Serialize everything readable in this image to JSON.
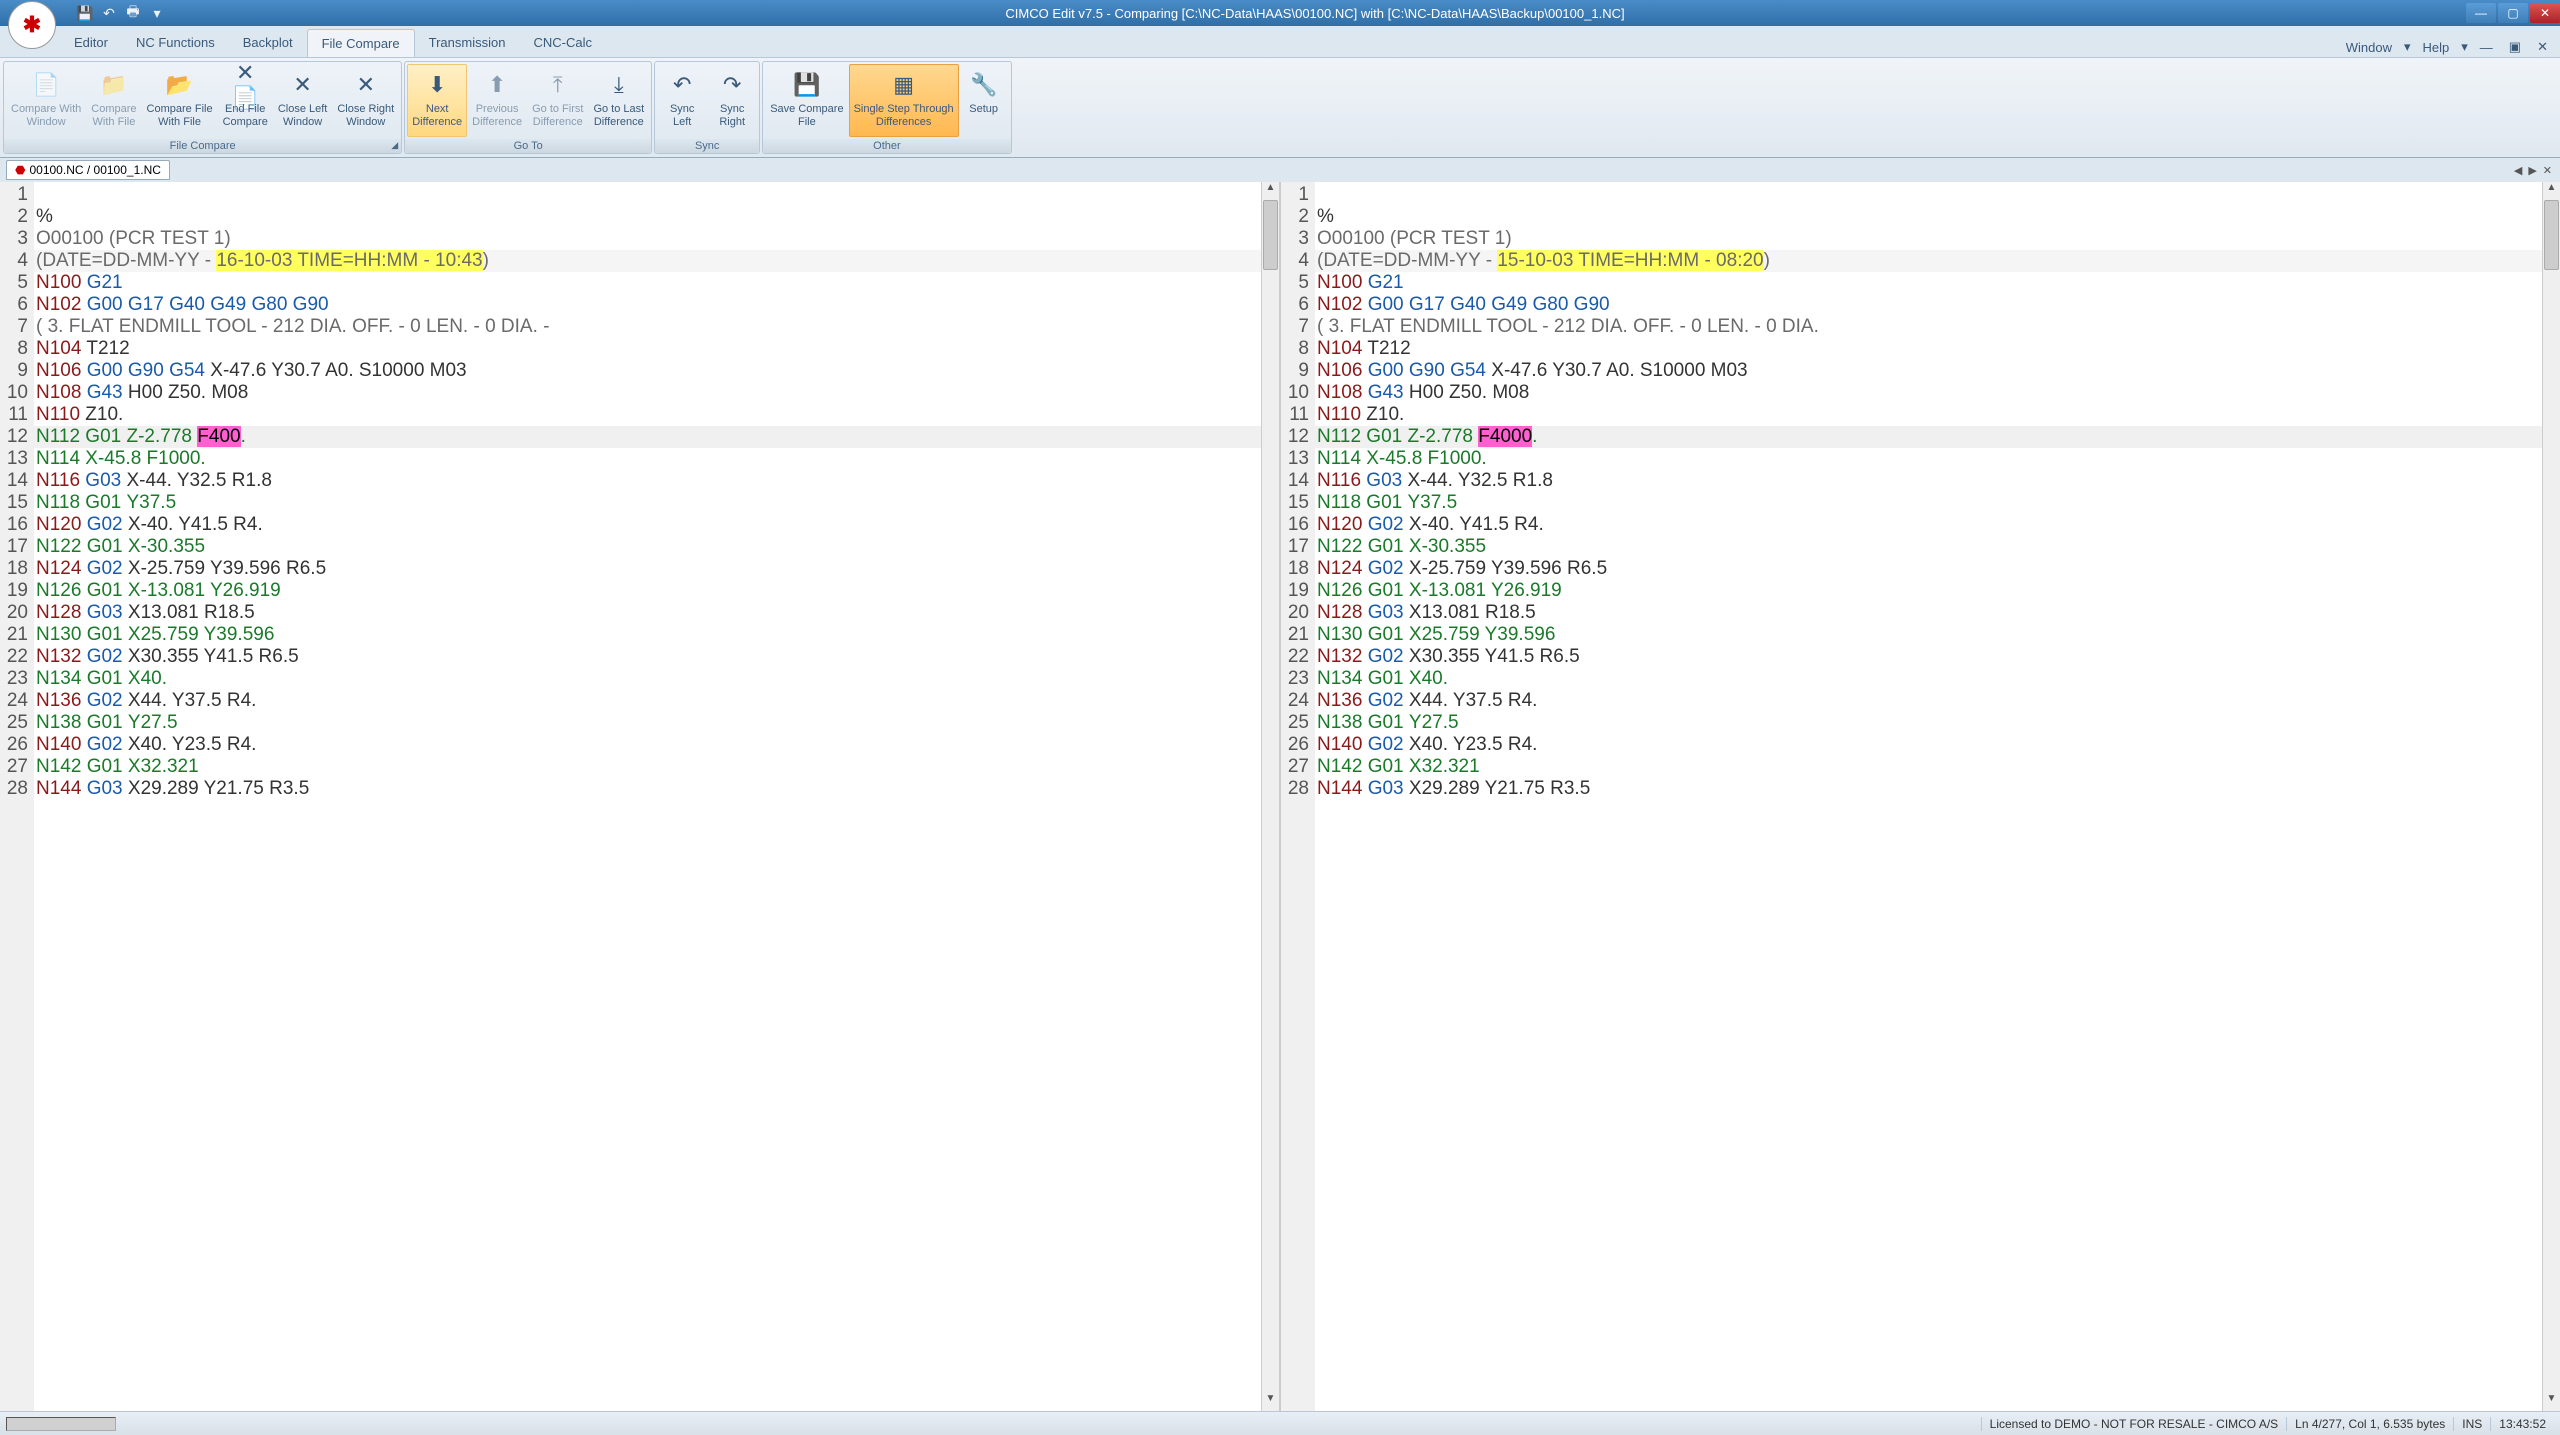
{
  "title": "CIMCO Edit v7.5 - Comparing [C:\\NC-Data\\HAAS\\00100.NC] with [C:\\NC-Data\\HAAS\\Backup\\00100_1.NC]",
  "menu_tabs": [
    "Editor",
    "NC Functions",
    "Backplot",
    "File Compare",
    "Transmission",
    "CNC-Calc"
  ],
  "active_tab": "File Compare",
  "menu_right": [
    "Window",
    "Help"
  ],
  "ribbon": {
    "groups": [
      {
        "label": "File Compare",
        "buttons": [
          {
            "label": "Compare With\nWindow",
            "icon": "📄",
            "disabled": true
          },
          {
            "label": "Compare\nWith File",
            "icon": "📁",
            "disabled": true
          },
          {
            "label": "Compare File\nWith File",
            "icon": "📂"
          },
          {
            "label": "End File\nCompare",
            "icon": "✕📄"
          },
          {
            "label": "Close Left\nWindow",
            "icon": "✕"
          },
          {
            "label": "Close Right\nWindow",
            "icon": "✕"
          }
        ],
        "launcher": true
      },
      {
        "label": "Go To",
        "buttons": [
          {
            "label": "Next\nDifference",
            "icon": "⬇",
            "highlight": true
          },
          {
            "label": "Previous\nDifference",
            "icon": "⬆",
            "disabled": true
          },
          {
            "label": "Go to First\nDifference",
            "icon": "⤒",
            "disabled": true
          },
          {
            "label": "Go to Last\nDifference",
            "icon": "⤓"
          }
        ]
      },
      {
        "label": "Sync",
        "buttons": [
          {
            "label": "Sync\nLeft",
            "icon": "↶"
          },
          {
            "label": "Sync\nRight",
            "icon": "↷"
          }
        ]
      },
      {
        "label": "Other",
        "buttons": [
          {
            "label": "Save Compare\nFile",
            "icon": "💾"
          },
          {
            "label": "Single Step Through\nDifferences",
            "icon": "▦",
            "orange": true
          },
          {
            "label": "Setup",
            "icon": "🔧"
          }
        ]
      }
    ]
  },
  "doc_tab": "00100.NC / 00100_1.NC",
  "left": {
    "lines": [
      {
        "n": 1,
        "tokens": [
          {
            "t": "",
            "c": "plain"
          }
        ]
      },
      {
        "n": 2,
        "tokens": [
          {
            "t": "%",
            "c": "plain"
          }
        ]
      },
      {
        "n": 3,
        "tokens": [
          {
            "t": "O00100 (PCR TEST 1)",
            "c": "comment"
          }
        ]
      },
      {
        "n": 4,
        "diff": true,
        "tokens": [
          {
            "t": "(DATE=DD-MM-YY - ",
            "c": "comment"
          },
          {
            "t": "16-10-03 TIME=HH:MM - 10:43",
            "c": "comment",
            "hl": "yellow"
          },
          {
            "t": ")",
            "c": "comment"
          }
        ]
      },
      {
        "n": 5,
        "tokens": [
          {
            "t": "N100 ",
            "c": "n"
          },
          {
            "t": "G21",
            "c": "g"
          }
        ]
      },
      {
        "n": 6,
        "tokens": [
          {
            "t": "N102 ",
            "c": "n"
          },
          {
            "t": "G00 G17 G40 G49 G80 G90",
            "c": "g"
          }
        ]
      },
      {
        "n": 7,
        "tokens": [
          {
            "t": "( 3. FLAT ENDMILL TOOL - 212 DIA. OFF. - 0 LEN. - 0 DIA. -",
            "c": "comment"
          }
        ]
      },
      {
        "n": 8,
        "tokens": [
          {
            "t": "N104 ",
            "c": "n"
          },
          {
            "t": "T212",
            "c": "plain"
          }
        ]
      },
      {
        "n": 9,
        "tokens": [
          {
            "t": "N106 ",
            "c": "n"
          },
          {
            "t": "G00 G90 G54 ",
            "c": "g"
          },
          {
            "t": "X-47.6 Y30.7 A0. S10000 M03",
            "c": "plain"
          }
        ]
      },
      {
        "n": 10,
        "tokens": [
          {
            "t": "N108 ",
            "c": "n"
          },
          {
            "t": "G43 ",
            "c": "g"
          },
          {
            "t": "H00 Z50. M08",
            "c": "plain"
          }
        ]
      },
      {
        "n": 11,
        "tokens": [
          {
            "t": "N110 ",
            "c": "n"
          },
          {
            "t": "Z10.",
            "c": "plain"
          }
        ]
      },
      {
        "n": 12,
        "diff2": true,
        "tokens": [
          {
            "t": "N112 ",
            "c": "gol"
          },
          {
            "t": "G01 ",
            "c": "gol"
          },
          {
            "t": "Z-2.778 ",
            "c": "coord"
          },
          {
            "t": "F400",
            "c": "feed",
            "hl": "pink"
          },
          {
            "t": ".",
            "c": "feed"
          }
        ]
      },
      {
        "n": 13,
        "tokens": [
          {
            "t": "N114 ",
            "c": "gol"
          },
          {
            "t": "X-45.8 F1000.",
            "c": "coord"
          }
        ]
      },
      {
        "n": 14,
        "tokens": [
          {
            "t": "N116 ",
            "c": "n"
          },
          {
            "t": "G03 ",
            "c": "g"
          },
          {
            "t": "X-44. Y32.5 R1.8",
            "c": "plain"
          }
        ]
      },
      {
        "n": 15,
        "tokens": [
          {
            "t": "N118 ",
            "c": "gol"
          },
          {
            "t": "G01 ",
            "c": "gol"
          },
          {
            "t": "Y37.5",
            "c": "coord"
          }
        ]
      },
      {
        "n": 16,
        "tokens": [
          {
            "t": "N120 ",
            "c": "n"
          },
          {
            "t": "G02 ",
            "c": "g"
          },
          {
            "t": "X-40. Y41.5 R4.",
            "c": "plain"
          }
        ]
      },
      {
        "n": 17,
        "tokens": [
          {
            "t": "N122 ",
            "c": "gol"
          },
          {
            "t": "G01 ",
            "c": "gol"
          },
          {
            "t": "X-30.355",
            "c": "coord"
          }
        ]
      },
      {
        "n": 18,
        "tokens": [
          {
            "t": "N124 ",
            "c": "n"
          },
          {
            "t": "G02 ",
            "c": "g"
          },
          {
            "t": "X-25.759 Y39.596 R6.5",
            "c": "plain"
          }
        ]
      },
      {
        "n": 19,
        "tokens": [
          {
            "t": "N126 ",
            "c": "gol"
          },
          {
            "t": "G01 ",
            "c": "gol"
          },
          {
            "t": "X-13.081 Y26.919",
            "c": "coord"
          }
        ]
      },
      {
        "n": 20,
        "tokens": [
          {
            "t": "N128 ",
            "c": "n"
          },
          {
            "t": "G03 ",
            "c": "g"
          },
          {
            "t": "X13.081 R18.5",
            "c": "plain"
          }
        ]
      },
      {
        "n": 21,
        "tokens": [
          {
            "t": "N130 ",
            "c": "gol"
          },
          {
            "t": "G01 ",
            "c": "gol"
          },
          {
            "t": "X25.759 Y39.596",
            "c": "coord"
          }
        ]
      },
      {
        "n": 22,
        "tokens": [
          {
            "t": "N132 ",
            "c": "n"
          },
          {
            "t": "G02 ",
            "c": "g"
          },
          {
            "t": "X30.355 Y41.5 R6.5",
            "c": "plain"
          }
        ]
      },
      {
        "n": 23,
        "tokens": [
          {
            "t": "N134 ",
            "c": "gol"
          },
          {
            "t": "G01 ",
            "c": "gol"
          },
          {
            "t": "X40.",
            "c": "coord"
          }
        ]
      },
      {
        "n": 24,
        "tokens": [
          {
            "t": "N136 ",
            "c": "n"
          },
          {
            "t": "G02 ",
            "c": "g"
          },
          {
            "t": "X44. Y37.5 R4.",
            "c": "plain"
          }
        ]
      },
      {
        "n": 25,
        "tokens": [
          {
            "t": "N138 ",
            "c": "gol"
          },
          {
            "t": "G01 ",
            "c": "gol"
          },
          {
            "t": "Y27.5",
            "c": "coord"
          }
        ]
      },
      {
        "n": 26,
        "tokens": [
          {
            "t": "N140 ",
            "c": "n"
          },
          {
            "t": "G02 ",
            "c": "g"
          },
          {
            "t": "X40. Y23.5 R4.",
            "c": "plain"
          }
        ]
      },
      {
        "n": 27,
        "tokens": [
          {
            "t": "N142 ",
            "c": "gol"
          },
          {
            "t": "G01 ",
            "c": "gol"
          },
          {
            "t": "X32.321",
            "c": "coord"
          }
        ]
      },
      {
        "n": 28,
        "tokens": [
          {
            "t": "N144 ",
            "c": "n"
          },
          {
            "t": "G03 ",
            "c": "g"
          },
          {
            "t": "X29.289 Y21.75 R3.5",
            "c": "plain"
          }
        ]
      }
    ]
  },
  "right": {
    "lines": [
      {
        "n": 1,
        "tokens": [
          {
            "t": "",
            "c": "plain"
          }
        ]
      },
      {
        "n": 2,
        "tokens": [
          {
            "t": "%",
            "c": "plain"
          }
        ]
      },
      {
        "n": 3,
        "tokens": [
          {
            "t": "O00100 (PCR TEST 1)",
            "c": "comment"
          }
        ]
      },
      {
        "n": 4,
        "diff": true,
        "tokens": [
          {
            "t": "(DATE=DD-MM-YY - ",
            "c": "comment"
          },
          {
            "t": "15-10-03 TIME=HH:MM - 08:20",
            "c": "comment",
            "hl": "yellow"
          },
          {
            "t": ")",
            "c": "comment"
          }
        ]
      },
      {
        "n": 5,
        "tokens": [
          {
            "t": "N100 ",
            "c": "n"
          },
          {
            "t": "G21",
            "c": "g"
          }
        ]
      },
      {
        "n": 6,
        "tokens": [
          {
            "t": "N102 ",
            "c": "n"
          },
          {
            "t": "G00 G17 G40 G49 G80 G90",
            "c": "g"
          }
        ]
      },
      {
        "n": 7,
        "tokens": [
          {
            "t": "( 3. FLAT ENDMILL TOOL - 212 DIA. OFF. - 0 LEN. - 0 DIA.",
            "c": "comment"
          }
        ]
      },
      {
        "n": 8,
        "tokens": [
          {
            "t": "N104 ",
            "c": "n"
          },
          {
            "t": "T212",
            "c": "plain"
          }
        ]
      },
      {
        "n": 9,
        "tokens": [
          {
            "t": "N106 ",
            "c": "n"
          },
          {
            "t": "G00 G90 G54 ",
            "c": "g"
          },
          {
            "t": "X-47.6 Y30.7 A0. S10000 M03",
            "c": "plain"
          }
        ]
      },
      {
        "n": 10,
        "tokens": [
          {
            "t": "N108 ",
            "c": "n"
          },
          {
            "t": "G43 ",
            "c": "g"
          },
          {
            "t": "H00 Z50. M08",
            "c": "plain"
          }
        ]
      },
      {
        "n": 11,
        "tokens": [
          {
            "t": "N110 ",
            "c": "n"
          },
          {
            "t": "Z10.",
            "c": "plain"
          }
        ]
      },
      {
        "n": 12,
        "diff2": true,
        "tokens": [
          {
            "t": "N112 ",
            "c": "gol"
          },
          {
            "t": "G01 ",
            "c": "gol"
          },
          {
            "t": "Z-2.778 ",
            "c": "coord"
          },
          {
            "t": "F4000",
            "c": "feed",
            "hl": "pink"
          },
          {
            "t": ".",
            "c": "feed"
          }
        ]
      },
      {
        "n": 13,
        "tokens": [
          {
            "t": "N114 ",
            "c": "gol"
          },
          {
            "t": "X-45.8 F1000.",
            "c": "coord"
          }
        ]
      },
      {
        "n": 14,
        "tokens": [
          {
            "t": "N116 ",
            "c": "n"
          },
          {
            "t": "G03 ",
            "c": "g"
          },
          {
            "t": "X-44. Y32.5 R1.8",
            "c": "plain"
          }
        ]
      },
      {
        "n": 15,
        "tokens": [
          {
            "t": "N118 ",
            "c": "gol"
          },
          {
            "t": "G01 ",
            "c": "gol"
          },
          {
            "t": "Y37.5",
            "c": "coord"
          }
        ]
      },
      {
        "n": 16,
        "tokens": [
          {
            "t": "N120 ",
            "c": "n"
          },
          {
            "t": "G02 ",
            "c": "g"
          },
          {
            "t": "X-40. Y41.5 R4.",
            "c": "plain"
          }
        ]
      },
      {
        "n": 17,
        "tokens": [
          {
            "t": "N122 ",
            "c": "gol"
          },
          {
            "t": "G01 ",
            "c": "gol"
          },
          {
            "t": "X-30.355",
            "c": "coord"
          }
        ]
      },
      {
        "n": 18,
        "tokens": [
          {
            "t": "N124 ",
            "c": "n"
          },
          {
            "t": "G02 ",
            "c": "g"
          },
          {
            "t": "X-25.759 Y39.596 R6.5",
            "c": "plain"
          }
        ]
      },
      {
        "n": 19,
        "tokens": [
          {
            "t": "N126 ",
            "c": "gol"
          },
          {
            "t": "G01 ",
            "c": "gol"
          },
          {
            "t": "X-13.081 Y26.919",
            "c": "coord"
          }
        ]
      },
      {
        "n": 20,
        "tokens": [
          {
            "t": "N128 ",
            "c": "n"
          },
          {
            "t": "G03 ",
            "c": "g"
          },
          {
            "t": "X13.081 R18.5",
            "c": "plain"
          }
        ]
      },
      {
        "n": 21,
        "tokens": [
          {
            "t": "N130 ",
            "c": "gol"
          },
          {
            "t": "G01 ",
            "c": "gol"
          },
          {
            "t": "X25.759 Y39.596",
            "c": "coord"
          }
        ]
      },
      {
        "n": 22,
        "tokens": [
          {
            "t": "N132 ",
            "c": "n"
          },
          {
            "t": "G02 ",
            "c": "g"
          },
          {
            "t": "X30.355 Y41.5 R6.5",
            "c": "plain"
          }
        ]
      },
      {
        "n": 23,
        "tokens": [
          {
            "t": "N134 ",
            "c": "gol"
          },
          {
            "t": "G01 ",
            "c": "gol"
          },
          {
            "t": "X40.",
            "c": "coord"
          }
        ]
      },
      {
        "n": 24,
        "tokens": [
          {
            "t": "N136 ",
            "c": "n"
          },
          {
            "t": "G02 ",
            "c": "g"
          },
          {
            "t": "X44. Y37.5 R4.",
            "c": "plain"
          }
        ]
      },
      {
        "n": 25,
        "tokens": [
          {
            "t": "N138 ",
            "c": "gol"
          },
          {
            "t": "G01 ",
            "c": "gol"
          },
          {
            "t": "Y27.5",
            "c": "coord"
          }
        ]
      },
      {
        "n": 26,
        "tokens": [
          {
            "t": "N140 ",
            "c": "n"
          },
          {
            "t": "G02 ",
            "c": "g"
          },
          {
            "t": "X40. Y23.5 R4.",
            "c": "plain"
          }
        ]
      },
      {
        "n": 27,
        "tokens": [
          {
            "t": "N142 ",
            "c": "gol"
          },
          {
            "t": "G01 ",
            "c": "gol"
          },
          {
            "t": "X32.321",
            "c": "coord"
          }
        ]
      },
      {
        "n": 28,
        "tokens": [
          {
            "t": "N144 ",
            "c": "n"
          },
          {
            "t": "G03 ",
            "c": "g"
          },
          {
            "t": "X29.289 Y21.75 R3.5",
            "c": "plain"
          }
        ]
      }
    ]
  },
  "status": {
    "license": "Licensed to DEMO - NOT FOR RESALE - CIMCO A/S",
    "pos": "Ln 4/277, Col 1, 6.535 bytes",
    "ins": "INS",
    "time": "13:43:52"
  }
}
